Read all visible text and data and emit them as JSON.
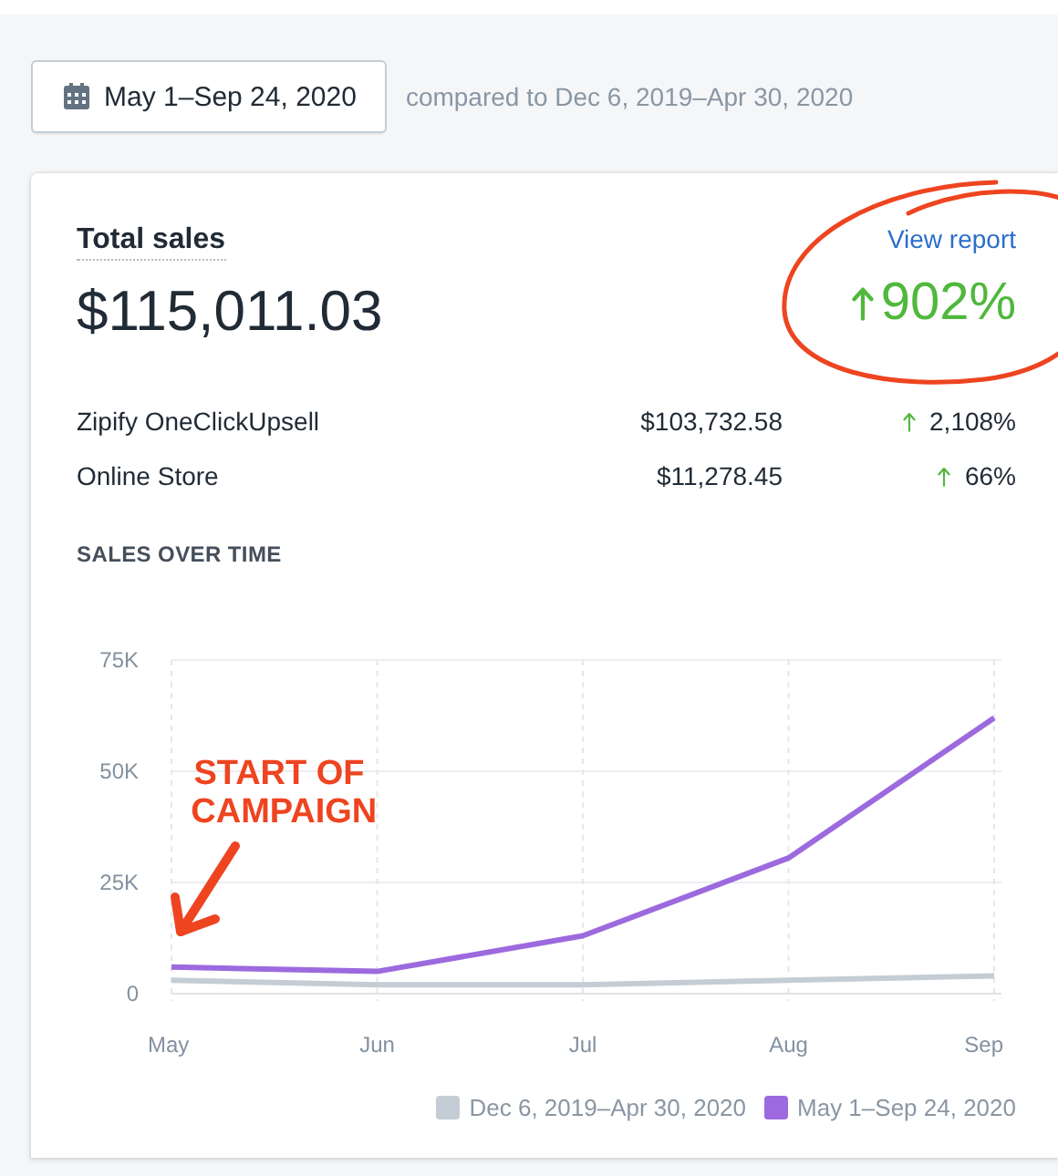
{
  "date_range": {
    "label": "May 1–Sep 24, 2020",
    "comparison": "compared to Dec 6, 2019–Apr 30, 2020"
  },
  "card": {
    "title": "Total sales",
    "total": "$115,011.03",
    "link": "View report",
    "change": "902%",
    "rows": [
      {
        "name": "Zipify OneClickUpsell",
        "amount": "$103,732.58",
        "change": "2,108%"
      },
      {
        "name": "Online Store",
        "amount": "$11,278.45",
        "change": "66%"
      }
    ],
    "chart_title": "SALES OVER TIME",
    "chart_data": {
      "type": "line",
      "grid": true,
      "legend": true,
      "categories": [
        "May",
        "Jun",
        "Jul",
        "Aug",
        "Sep"
      ],
      "ylim": [
        0,
        75000
      ],
      "yticks": [
        {
          "value": 0,
          "label": "0"
        },
        {
          "value": 25000,
          "label": "25K"
        },
        {
          "value": 50000,
          "label": "50K"
        },
        {
          "value": 75000,
          "label": "75K"
        }
      ],
      "series": [
        {
          "name": "Dec 6, 2019–Apr 30, 2020",
          "color": "#c4cdd5",
          "values": [
            3000,
            2000,
            2000,
            3000,
            4000
          ]
        },
        {
          "name": "May 1–Sep 24, 2020",
          "color": "#9c6ade",
          "values": [
            6000,
            5000,
            13000,
            30500,
            62000
          ]
        }
      ],
      "annotations": [
        {
          "text": "START OF CAMPAIGN"
        }
      ]
    }
  }
}
